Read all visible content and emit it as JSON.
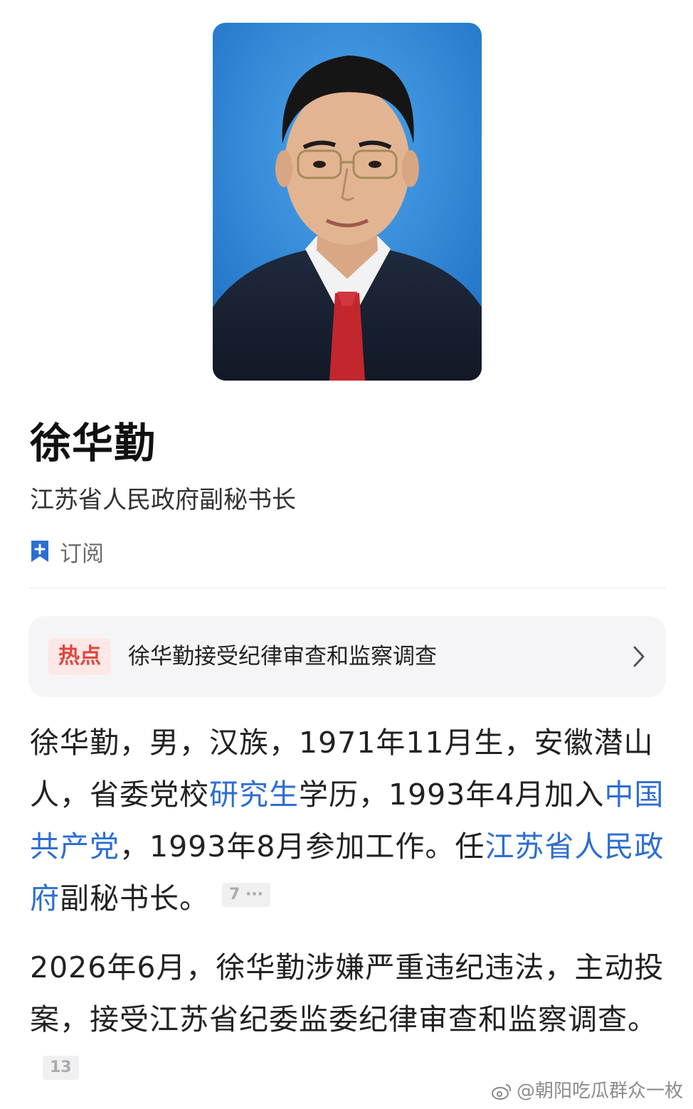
{
  "profile": {
    "name": "徐华勤",
    "title": "江苏省人民政府副秘书长",
    "subscribe_label": "订阅"
  },
  "hot": {
    "badge": "热点",
    "headline": "徐华勤接受纪律审查和监察调查"
  },
  "bio": {
    "p1_a": "徐华勤，男，汉族，1971年11月生，安徽潜山人，省委党校",
    "p1_link1": "研究生",
    "p1_b": "学历，1993年4月加入",
    "p1_link2": "中国共产党",
    "p1_c": "，1993年8月参加工作。任",
    "p1_link3": "江苏省人民政府",
    "p1_d": "副秘书长。",
    "p1_ref": "7 ···",
    "p2": "2026年6月，徐华勤涉嫌严重违纪违法，主动投案，接受江苏省纪委监委纪律审查和监察调查。",
    "p2_ref": "13"
  },
  "watermark": "@朝阳吃瓜群众一枚",
  "colors": {
    "link": "#2d6ed1",
    "hot_badge_text": "#e0463d",
    "hot_badge_bg": "#fde7e7",
    "bookmark_icon": "#2d6ed1",
    "photo_background": "#2f86d6"
  }
}
